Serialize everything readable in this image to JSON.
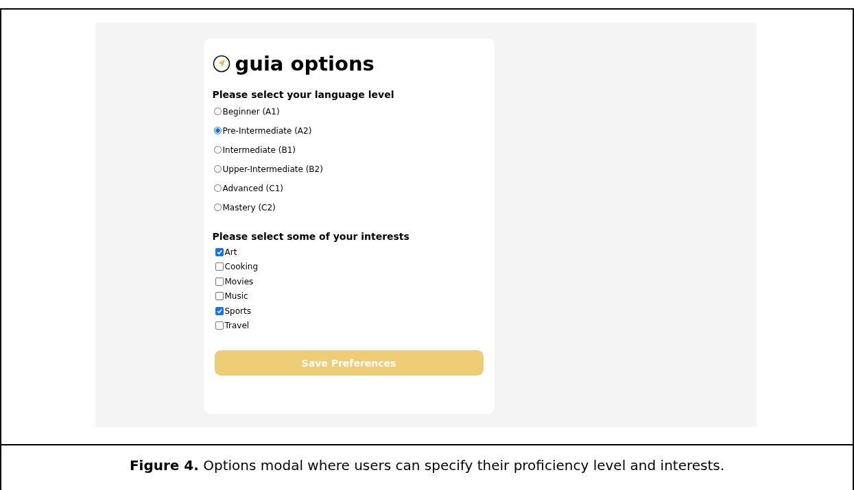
{
  "app": {
    "title": "guia options",
    "level_section": {
      "heading": "Please select your language level",
      "options": [
        {
          "label": "Beginner (A1)",
          "selected": false
        },
        {
          "label": "Pre-Intermediate (A2)",
          "selected": true
        },
        {
          "label": "Intermediate (B1)",
          "selected": false
        },
        {
          "label": "Upper-Intermediate (B2)",
          "selected": false
        },
        {
          "label": "Advanced (C1)",
          "selected": false
        },
        {
          "label": "Mastery (C2)",
          "selected": false
        }
      ]
    },
    "interests_section": {
      "heading": "Please select some of your interests",
      "options": [
        {
          "label": "Art",
          "checked": true
        },
        {
          "label": "Cooking",
          "checked": false
        },
        {
          "label": "Movies",
          "checked": false
        },
        {
          "label": "Music",
          "checked": false
        },
        {
          "label": "Sports",
          "checked": true
        },
        {
          "label": "Travel",
          "checked": false
        }
      ]
    },
    "save_button": {
      "label": "Save Preferences"
    }
  },
  "caption": "**Figure 4.** Options modal where users can specify their proficiency level and interests."
}
